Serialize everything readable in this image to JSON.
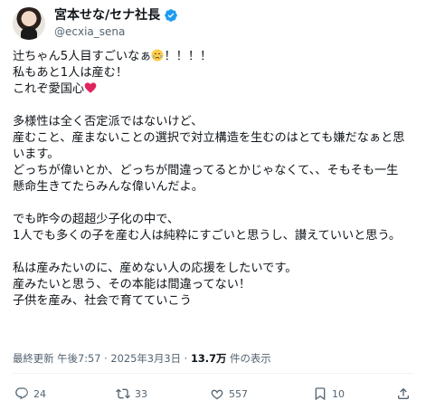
{
  "author": {
    "display_name": "宮本せな/セナ社長",
    "handle": "@ecxia_sena",
    "avatar_icon": "profile-photo",
    "verified_icon": "verified-badge-icon",
    "verified_color": "#1d9bf0"
  },
  "tweet": {
    "lines": [
      "辻ちゃん5人目すごいなぁ",
      "！！！！",
      "私もあと1人は産む！",
      "これぞ愛国心",
      "多様性は全く否定派ではないけど、",
      "産むこと、産まないことの選択で対立構造を生むのはとても嫌だなぁと思",
      "います。",
      "どっちが偉いとか、どっちが間違ってるとかじゃなくて、、そもそも一生",
      "懸命生きてたらみんな偉いんだよ。",
      "でも昨今の超超少子化の中で、",
      "1人でも多くの子を産む人は純粋にすごいと思うし、讃えていいと思う。",
      "私は産みたいのに、産めない人の応援をしたいです。",
      "産みたいと思う、その本能は間違ってない！",
      "子供を産み、社会で育てていこう"
    ],
    "emoji_crying": "crying-face-emoji",
    "emoji_heart": "red-heart-emoji",
    "heart_color": "#e0245e"
  },
  "meta": {
    "updated_label": "最終更新 午後7:57 · 2025年3月3日 · ",
    "views_count": "13.7万",
    "views_label": " 件の表示"
  },
  "actions": {
    "reply_count": "24",
    "repost_count": "33",
    "like_count": "557",
    "bookmark_count": "10",
    "icon_color": "#536471"
  }
}
